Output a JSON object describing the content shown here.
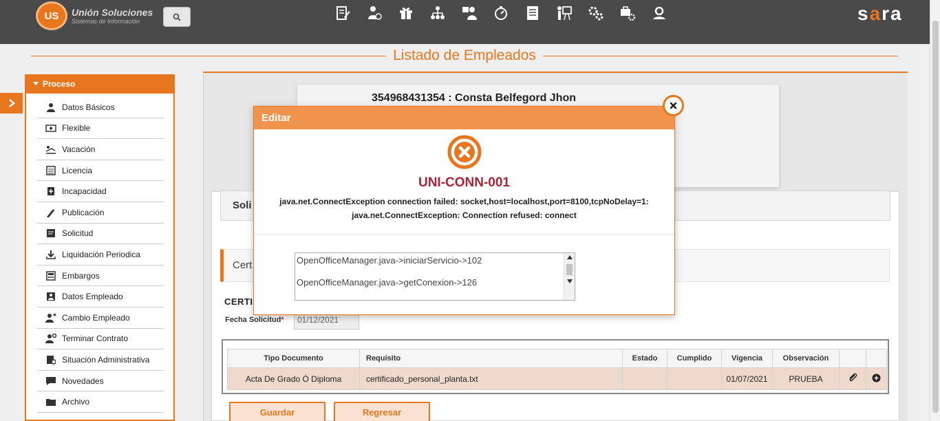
{
  "header": {
    "logo_mark": "US",
    "logo_name": "Unión Soluciones",
    "logo_subtitle": "Sistemas de Información",
    "brand": "sara",
    "nav_icons": [
      "document-edit-icon",
      "user-cash-icon",
      "gift-icon",
      "org-chart-icon",
      "user-group-icon",
      "stopwatch-icon",
      "report-icon",
      "presentation-icon",
      "gears-icon",
      "truck-settings-icon",
      "user-search-icon"
    ]
  },
  "page": {
    "title": "Listado de Empleados"
  },
  "sidebar": {
    "header": "Proceso",
    "items": [
      {
        "label": "Datos Básicos",
        "icon": "user-icon"
      },
      {
        "label": "Flexible",
        "icon": "money-icon"
      },
      {
        "label": "Vacación",
        "icon": "beach-icon"
      },
      {
        "label": "Licencia",
        "icon": "list-icon"
      },
      {
        "label": "Incapacidad",
        "icon": "medical-doc-icon"
      },
      {
        "label": "Publicación",
        "icon": "pen-icon"
      },
      {
        "label": "Solicitud",
        "icon": "form-icon"
      },
      {
        "label": "Liquidación Periodica",
        "icon": "download-icon"
      },
      {
        "label": "Embargos",
        "icon": "calculator-icon"
      },
      {
        "label": "Datos Empleado",
        "icon": "id-card-icon"
      },
      {
        "label": "Cambio Empleado",
        "icon": "user-change-icon"
      },
      {
        "label": "Terminar Contrato",
        "icon": "user-end-icon"
      },
      {
        "label": "Situación Administrativa",
        "icon": "doc-user-icon"
      },
      {
        "label": "Novedades",
        "icon": "chat-icon"
      },
      {
        "label": "Archivo",
        "icon": "folder-icon"
      }
    ]
  },
  "employee": {
    "name": "354968431354 : Consta Belfegord Jhon"
  },
  "section": {
    "soli_label": "Soli",
    "cert_label": "Cert",
    "certi_label": "CERTI",
    "fecha_label": "Fecha Solicitud",
    "fecha_required": "*",
    "fecha_value": "01/12/2021"
  },
  "table": {
    "headers": [
      "Tipo Documento",
      "Requisito",
      "Estado",
      "Cumplido",
      "Vigencia",
      "Observación",
      "",
      ""
    ],
    "rows": [
      [
        "Acta De Grado Ó Diploma",
        "certificado_personal_planta.txt",
        "",
        "",
        "01/07/2021",
        "PRUEBA"
      ]
    ]
  },
  "buttons": {
    "save": "Guardar",
    "back": "Regresar"
  },
  "modal": {
    "title": "Editar",
    "error_code": "UNI-CONN-001",
    "error_line1": "java.net.ConnectException connection failed: socket,host=localhost,port=8100,tcpNoDelay=1:",
    "error_line2": "java.net.ConnectException: Connection refused: connect",
    "trace_lines": [
      "OpenOfficeManager.java->iniciarServicio->102",
      "OpenOfficeManager.java->getConexion->126"
    ]
  },
  "colors": {
    "accent": "#e8761f",
    "error": "#a5263a",
    "topbar": "#4a4a4a"
  }
}
